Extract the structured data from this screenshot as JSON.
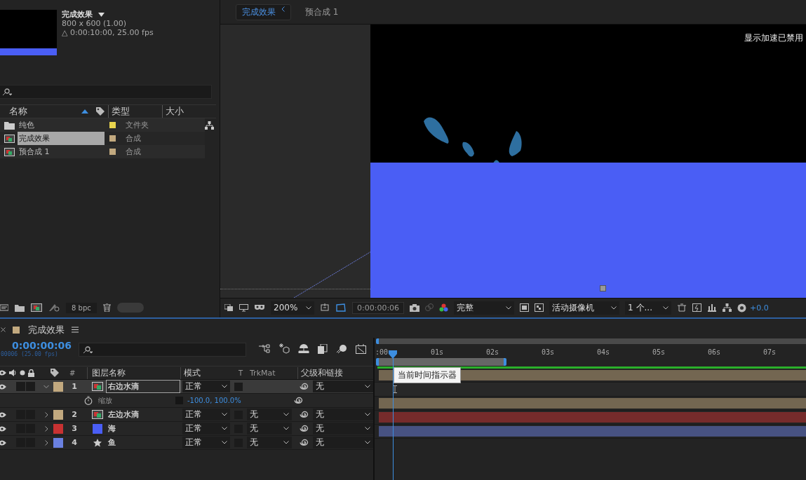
{
  "project": {
    "comp_name": "完成效果",
    "resolution": "800 x 600 (1.00)",
    "duration": "△ 0:00:10:00, 25.00 fps",
    "columns": [
      "名称",
      "类型",
      "大小"
    ],
    "items": [
      {
        "name": "纯色",
        "type": "文件夹",
        "kind": "folder",
        "color": "#e8d44d",
        "selected": false
      },
      {
        "name": "完成效果",
        "type": "合成",
        "kind": "comp",
        "color": "#c2a97f",
        "selected": true
      },
      {
        "name": "预合成 1",
        "type": "合成",
        "kind": "comp",
        "color": "#c2a97f",
        "selected": false
      }
    ],
    "bpc": "8 bpc"
  },
  "viewer": {
    "tabs": [
      {
        "label": "完成效果",
        "selected": true
      },
      {
        "label": "预合成 1",
        "selected": false
      }
    ],
    "notice": "显示加速已禁用",
    "zoom": "200%",
    "time": "0:00:00:06",
    "quality": "完整",
    "camera": "活动摄像机",
    "views": "1 个...",
    "exposure": "+0.0"
  },
  "timeline": {
    "tab": "完成效果",
    "time": "0:00:00:06",
    "frames": "00006 (25.00 fps)",
    "columns": [
      "#",
      "图层名称",
      "模式",
      "T",
      "TrkMat",
      "父级和链接"
    ],
    "ruler": [
      ":00",
      "01s",
      "02s",
      "03s",
      "04s",
      "05s",
      "06s",
      "07s"
    ],
    "tooltip": "当前时间指示器",
    "layers": [
      {
        "num": "1",
        "name": "右边水滴",
        "kind": "comp",
        "color": "#c2a97f",
        "expanded": true,
        "selected": true,
        "mode": "正常",
        "parent": "无",
        "children": [
          {
            "name": "缩放",
            "value": "-100.0, 100.0%"
          }
        ]
      },
      {
        "num": "2",
        "name": "左边水滴",
        "kind": "comp",
        "color": "#c2a97f",
        "expanded": false,
        "selected": false,
        "mode": "正常",
        "trkmat": "无",
        "parent": "无"
      },
      {
        "num": "3",
        "name": "海",
        "kind": "solid",
        "color": "#c83232",
        "expanded": false,
        "selected": false,
        "mode": "正常",
        "trkmat": "无",
        "parent": "无"
      },
      {
        "num": "4",
        "name": "鱼",
        "kind": "shape",
        "color": "#6a80e0",
        "expanded": false,
        "selected": false,
        "mode": "正常",
        "trkmat": "无",
        "parent": "无"
      }
    ]
  }
}
